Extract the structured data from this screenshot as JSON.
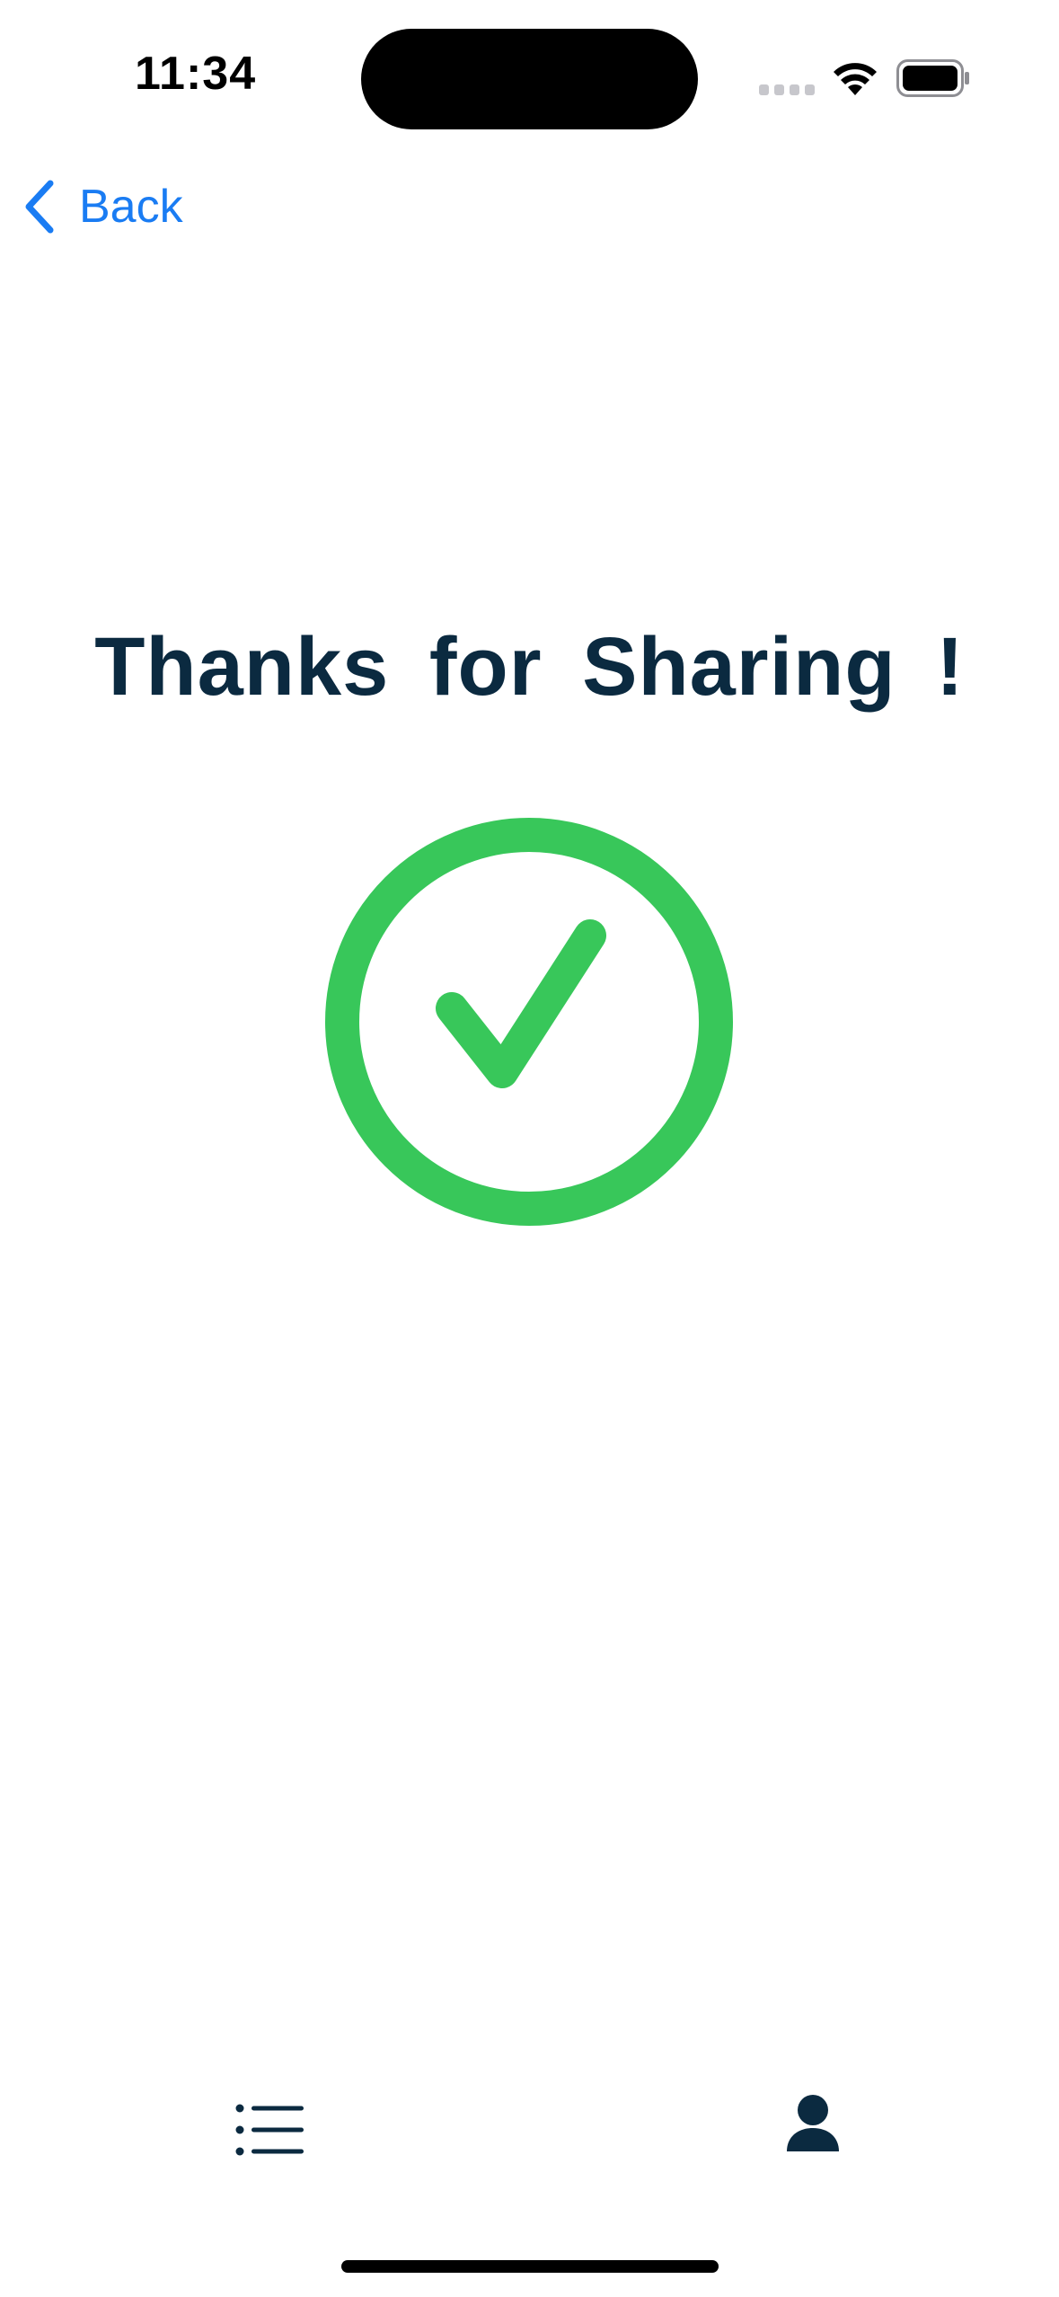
{
  "status_bar": {
    "time": "11:34",
    "icons": [
      "signal-dots-icon",
      "wifi-icon",
      "battery-icon"
    ]
  },
  "nav": {
    "back_label": "Back",
    "back_icon": "chevron-left-icon"
  },
  "main": {
    "title": "Thanks for Sharing !",
    "status_icon": "check-circle-icon"
  },
  "tab_bar": {
    "items": [
      {
        "icon": "list-icon"
      },
      {
        "icon": "person-icon"
      }
    ]
  },
  "colors": {
    "accent": "#1a7cf3",
    "title": "#0b2a40",
    "success": "#38c75a",
    "tab_icon": "#0b2a40",
    "background": "#ffffff"
  }
}
